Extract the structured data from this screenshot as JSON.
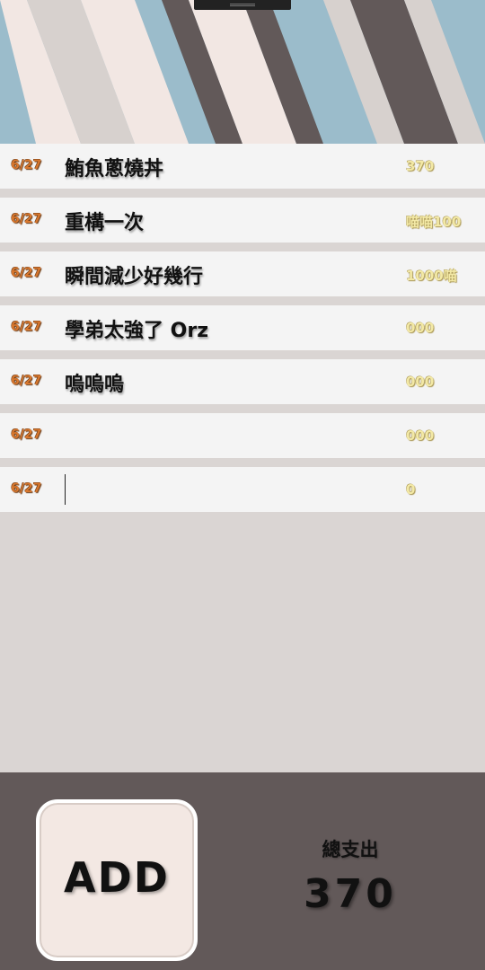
{
  "colors": {
    "banner_blue": "#9bbccb",
    "stripe_light": "#f2e7e3",
    "stripe_gray": "#d7d1ce",
    "stripe_dark": "#625959",
    "row_bg": "#f4f4f4",
    "page_bg": "#dad5d3",
    "date_orange": "#d8772e",
    "amount_yellow": "#f3e9a6",
    "footer_bg": "#625959"
  },
  "entries": [
    {
      "date": "6/27",
      "name": "鮪魚蔥燒丼",
      "amount": "370"
    },
    {
      "date": "6/27",
      "name": "重構一次",
      "amount": "喵喵100"
    },
    {
      "date": "6/27",
      "name": "瞬間減少好幾行",
      "amount": "1000喵"
    },
    {
      "date": "6/27",
      "name": "學弟太強了 Orz",
      "amount": "000"
    },
    {
      "date": "6/27",
      "name": "嗚嗚嗚",
      "amount": "000"
    },
    {
      "date": "6/27",
      "name": "",
      "amount": "000"
    },
    {
      "date": "6/27",
      "name": "",
      "amount": "0"
    }
  ],
  "footer": {
    "add_label": "ADD",
    "total_label": "總支出",
    "total_value": "370"
  }
}
